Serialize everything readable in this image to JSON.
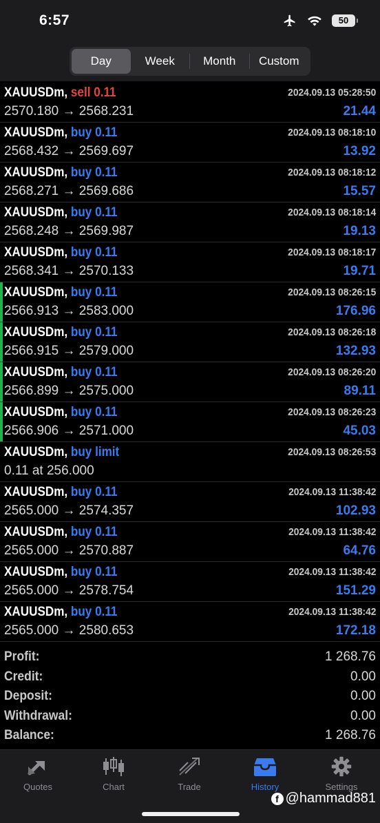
{
  "status": {
    "time": "6:57",
    "battery": "50"
  },
  "periods": [
    "Day",
    "Week",
    "Month",
    "Custom"
  ],
  "active_period": "Day",
  "deals": [
    {
      "symbol": "XAUUSDm,",
      "side": "sell 0.11",
      "side_type": "sell",
      "date": "2024.09.13 05:28:50",
      "prices": "2570.180 → 2568.231",
      "profit": "21.44",
      "accent": false
    },
    {
      "symbol": "XAUUSDm,",
      "side": "buy 0.11",
      "side_type": "buy",
      "date": "2024.09.13 08:18:10",
      "prices": "2568.432 → 2569.697",
      "profit": "13.92",
      "accent": false
    },
    {
      "symbol": "XAUUSDm,",
      "side": "buy 0.11",
      "side_type": "buy",
      "date": "2024.09.13 08:18:12",
      "prices": "2568.271 → 2569.686",
      "profit": "15.57",
      "accent": false
    },
    {
      "symbol": "XAUUSDm,",
      "side": "buy 0.11",
      "side_type": "buy",
      "date": "2024.09.13 08:18:14",
      "prices": "2568.248 → 2569.987",
      "profit": "19.13",
      "accent": false
    },
    {
      "symbol": "XAUUSDm,",
      "side": "buy 0.11",
      "side_type": "buy",
      "date": "2024.09.13 08:18:17",
      "prices": "2568.341 → 2570.133",
      "profit": "19.71",
      "accent": false
    },
    {
      "symbol": "XAUUSDm,",
      "side": "buy 0.11",
      "side_type": "buy",
      "date": "2024.09.13 08:26:15",
      "prices": "2566.913 → 2583.000",
      "profit": "176.96",
      "accent": true
    },
    {
      "symbol": "XAUUSDm,",
      "side": "buy 0.11",
      "side_type": "buy",
      "date": "2024.09.13 08:26:18",
      "prices": "2566.915 → 2579.000",
      "profit": "132.93",
      "accent": true
    },
    {
      "symbol": "XAUUSDm,",
      "side": "buy 0.11",
      "side_type": "buy",
      "date": "2024.09.13 08:26:20",
      "prices": "2566.899 → 2575.000",
      "profit": "89.11",
      "accent": true
    },
    {
      "symbol": "XAUUSDm,",
      "side": "buy 0.11",
      "side_type": "buy",
      "date": "2024.09.13 08:26:23",
      "prices": "2566.906 → 2571.000",
      "profit": "45.03",
      "accent": true
    },
    {
      "symbol": "XAUUSDm,",
      "side": "buy limit",
      "side_type": "buy",
      "date": "2024.09.13 08:26:53",
      "prices": "0.11 at 256.000",
      "profit": "",
      "accent": false
    },
    {
      "symbol": "XAUUSDm,",
      "side": "buy 0.11",
      "side_type": "buy",
      "date": "2024.09.13 11:38:42",
      "prices": "2565.000 → 2574.357",
      "profit": "102.93",
      "accent": false
    },
    {
      "symbol": "XAUUSDm,",
      "side": "buy 0.11",
      "side_type": "buy",
      "date": "2024.09.13 11:38:42",
      "prices": "2565.000 → 2570.887",
      "profit": "64.76",
      "accent": false
    },
    {
      "symbol": "XAUUSDm,",
      "side": "buy 0.11",
      "side_type": "buy",
      "date": "2024.09.13 11:38:42",
      "prices": "2565.000 → 2578.754",
      "profit": "151.29",
      "accent": false
    },
    {
      "symbol": "XAUUSDm,",
      "side": "buy 0.11",
      "side_type": "buy",
      "date": "2024.09.13 11:38:42",
      "prices": "2565.000 → 2580.653",
      "profit": "172.18",
      "accent": false
    }
  ],
  "summary": [
    {
      "label": "Profit:",
      "value": "1 268.76"
    },
    {
      "label": "Credit:",
      "value": "0.00"
    },
    {
      "label": "Deposit:",
      "value": "0.00"
    },
    {
      "label": "Withdrawal:",
      "value": "0.00"
    },
    {
      "label": "Balance:",
      "value": "1 268.76"
    }
  ],
  "tabs": [
    {
      "label": "Quotes",
      "icon": "quotes-icon"
    },
    {
      "label": "Chart",
      "icon": "chart-icon"
    },
    {
      "label": "Trade",
      "icon": "trade-icon"
    },
    {
      "label": "History",
      "icon": "history-icon"
    },
    {
      "label": "Settings",
      "icon": "gear-icon"
    }
  ],
  "active_tab": "History",
  "watermark": "@hammad881",
  "colors": {
    "sell": "#e5453b",
    "buy": "#3b7bf0",
    "accent": "#22b14c",
    "background": "#000000"
  }
}
